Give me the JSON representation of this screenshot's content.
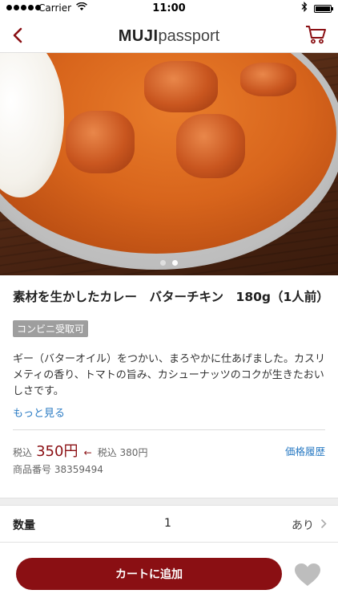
{
  "status_bar": {
    "carrier": "Carrier",
    "time": "11:00"
  },
  "nav": {
    "logo_brand": "MUJI",
    "logo_suffix": "passport",
    "back_icon": "chevron-left-icon",
    "cart_icon": "cart-icon",
    "accent_color": "#8a0f13"
  },
  "hero": {
    "image_count": 2,
    "active_index": 2
  },
  "product": {
    "title": "素材を生かしたカレー　バターチキン　180g（1人前）",
    "badge": "コンビニ受取可",
    "description": "ギー（バターオイル）をつかい、まろやかに仕あげました。カスリメティの香り、トマトの旨み、カシューナッツのコクが生きたおいしさです。",
    "more_link": "もっと見る",
    "price_label": "税込",
    "price": "350円",
    "old_price_label": "税込 380円",
    "price_history": "価格履歴",
    "product_number": "商品番号 38359494"
  },
  "order": {
    "quantity_label": "数量",
    "quantity_value": "1",
    "stock_status": "あり",
    "add_to_cart": "カートに追加",
    "favorite_icon": "heart-icon"
  }
}
